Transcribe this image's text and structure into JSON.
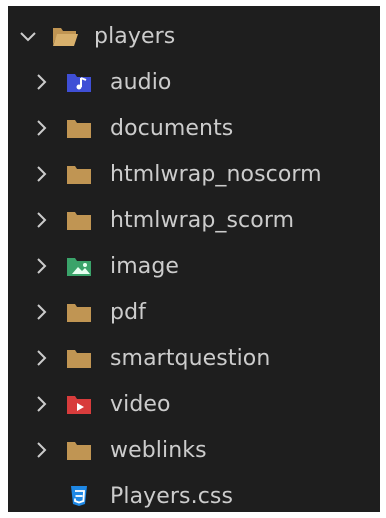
{
  "explorer": {
    "root": {
      "label": "players",
      "expanded": true,
      "icon": "folder-open-icon"
    },
    "children": [
      {
        "label": "audio",
        "icon": "audio-folder-icon",
        "type": "folder"
      },
      {
        "label": "documents",
        "icon": "folder-icon",
        "type": "folder"
      },
      {
        "label": "htmlwrap_noscorm",
        "icon": "folder-icon",
        "type": "folder"
      },
      {
        "label": "htmlwrap_scorm",
        "icon": "folder-icon",
        "type": "folder"
      },
      {
        "label": "image",
        "icon": "image-folder-icon",
        "type": "folder"
      },
      {
        "label": "pdf",
        "icon": "folder-icon",
        "type": "folder"
      },
      {
        "label": "smartquestion",
        "icon": "folder-icon",
        "type": "folder"
      },
      {
        "label": "video",
        "icon": "video-folder-icon",
        "type": "folder"
      },
      {
        "label": "weblinks",
        "icon": "folder-icon",
        "type": "folder"
      },
      {
        "label": "Players.css",
        "icon": "css3-file-icon",
        "type": "file"
      }
    ]
  },
  "colors": {
    "background": "#1e1e1e",
    "text": "#cccccc",
    "folder": "#c09553",
    "audio": "#3f4fd6",
    "image": "#3aa36a",
    "video": "#d83c3c",
    "css": "#1e88e5"
  }
}
